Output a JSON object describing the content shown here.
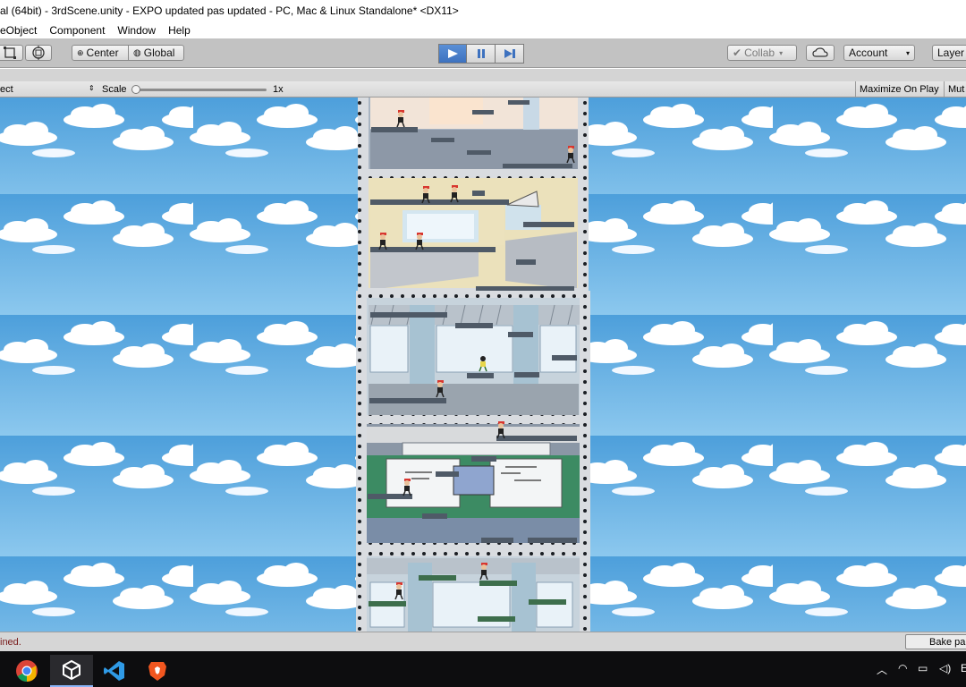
{
  "window": {
    "title": "al (64bit) - 3rdScene.unity - EXPO updated pas updated - PC, Mac & Linux Standalone* <DX11>"
  },
  "menu": {
    "items": [
      "eObject",
      "Component",
      "Window",
      "Help"
    ]
  },
  "toolbar": {
    "pivot_label": "Center",
    "space_label": "Global",
    "collab_label": "Collab",
    "account_label": "Account",
    "layers_label": "Layer",
    "play_state": "playing"
  },
  "game_view": {
    "aspect_label": "ect",
    "scale_label": "Scale",
    "scale_value": "1x",
    "maximize_label": "Maximize On Play",
    "mute_label": "Mut"
  },
  "status": {
    "message": "ined.",
    "bake_label": "Bake pa"
  },
  "taskbar": {
    "apps": [
      "chrome-icon",
      "unity-icon",
      "vscode-icon",
      "brave-icon"
    ],
    "active_app": "unity-icon"
  },
  "colors": {
    "sky": "#59a9e0",
    "play_active": "#4a80cc",
    "floor_wall": "#8b97a6",
    "green_panel": "#3c8b63"
  }
}
